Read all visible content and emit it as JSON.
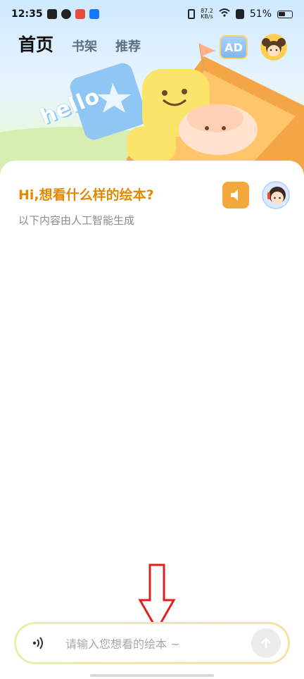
{
  "status_bar": {
    "time": "12:35",
    "net_speed_top": "87.2",
    "net_speed_unit": "KB/s",
    "battery": "51%"
  },
  "nav": {
    "home_label": "首页",
    "tab_bookshelf": "书架",
    "tab_recommend": "推荐",
    "ad_icon_text": "AD"
  },
  "hero": {
    "hello_text": "hello"
  },
  "chat": {
    "greeting": "Hi,想看什么样的绘本?",
    "subtitle": "以下内容由人工智能生成"
  },
  "input": {
    "placeholder": "请输入您想看的绘本 ~"
  },
  "colors": {
    "accent": "#e08a00",
    "speaker_bg": "#f2a93a",
    "arrow": "#e02020"
  }
}
